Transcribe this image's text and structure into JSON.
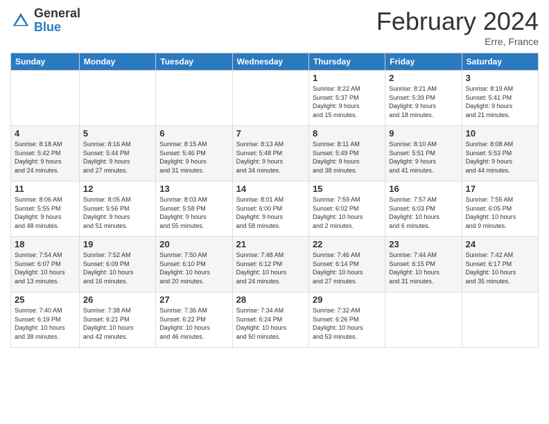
{
  "header": {
    "logo_general": "General",
    "logo_blue": "Blue",
    "month_title": "February 2024",
    "location": "Erre, France"
  },
  "days_of_week": [
    "Sunday",
    "Monday",
    "Tuesday",
    "Wednesday",
    "Thursday",
    "Friday",
    "Saturday"
  ],
  "weeks": [
    {
      "cells": [
        {
          "day": "",
          "info": ""
        },
        {
          "day": "",
          "info": ""
        },
        {
          "day": "",
          "info": ""
        },
        {
          "day": "",
          "info": ""
        },
        {
          "day": "1",
          "info": "Sunrise: 8:22 AM\nSunset: 5:37 PM\nDaylight: 9 hours\nand 15 minutes."
        },
        {
          "day": "2",
          "info": "Sunrise: 8:21 AM\nSunset: 5:39 PM\nDaylight: 9 hours\nand 18 minutes."
        },
        {
          "day": "3",
          "info": "Sunrise: 8:19 AM\nSunset: 5:41 PM\nDaylight: 9 hours\nand 21 minutes."
        }
      ]
    },
    {
      "cells": [
        {
          "day": "4",
          "info": "Sunrise: 8:18 AM\nSunset: 5:42 PM\nDaylight: 9 hours\nand 24 minutes."
        },
        {
          "day": "5",
          "info": "Sunrise: 8:16 AM\nSunset: 5:44 PM\nDaylight: 9 hours\nand 27 minutes."
        },
        {
          "day": "6",
          "info": "Sunrise: 8:15 AM\nSunset: 5:46 PM\nDaylight: 9 hours\nand 31 minutes."
        },
        {
          "day": "7",
          "info": "Sunrise: 8:13 AM\nSunset: 5:48 PM\nDaylight: 9 hours\nand 34 minutes."
        },
        {
          "day": "8",
          "info": "Sunrise: 8:11 AM\nSunset: 5:49 PM\nDaylight: 9 hours\nand 38 minutes."
        },
        {
          "day": "9",
          "info": "Sunrise: 8:10 AM\nSunset: 5:51 PM\nDaylight: 9 hours\nand 41 minutes."
        },
        {
          "day": "10",
          "info": "Sunrise: 8:08 AM\nSunset: 5:53 PM\nDaylight: 9 hours\nand 44 minutes."
        }
      ]
    },
    {
      "cells": [
        {
          "day": "11",
          "info": "Sunrise: 8:06 AM\nSunset: 5:55 PM\nDaylight: 9 hours\nand 48 minutes."
        },
        {
          "day": "12",
          "info": "Sunrise: 8:05 AM\nSunset: 5:56 PM\nDaylight: 9 hours\nand 51 minutes."
        },
        {
          "day": "13",
          "info": "Sunrise: 8:03 AM\nSunset: 5:58 PM\nDaylight: 9 hours\nand 55 minutes."
        },
        {
          "day": "14",
          "info": "Sunrise: 8:01 AM\nSunset: 6:00 PM\nDaylight: 9 hours\nand 58 minutes."
        },
        {
          "day": "15",
          "info": "Sunrise: 7:59 AM\nSunset: 6:02 PM\nDaylight: 10 hours\nand 2 minutes."
        },
        {
          "day": "16",
          "info": "Sunrise: 7:57 AM\nSunset: 6:03 PM\nDaylight: 10 hours\nand 6 minutes."
        },
        {
          "day": "17",
          "info": "Sunrise: 7:55 AM\nSunset: 6:05 PM\nDaylight: 10 hours\nand 9 minutes."
        }
      ]
    },
    {
      "cells": [
        {
          "day": "18",
          "info": "Sunrise: 7:54 AM\nSunset: 6:07 PM\nDaylight: 10 hours\nand 13 minutes."
        },
        {
          "day": "19",
          "info": "Sunrise: 7:52 AM\nSunset: 6:09 PM\nDaylight: 10 hours\nand 16 minutes."
        },
        {
          "day": "20",
          "info": "Sunrise: 7:50 AM\nSunset: 6:10 PM\nDaylight: 10 hours\nand 20 minutes."
        },
        {
          "day": "21",
          "info": "Sunrise: 7:48 AM\nSunset: 6:12 PM\nDaylight: 10 hours\nand 24 minutes."
        },
        {
          "day": "22",
          "info": "Sunrise: 7:46 AM\nSunset: 6:14 PM\nDaylight: 10 hours\nand 27 minutes."
        },
        {
          "day": "23",
          "info": "Sunrise: 7:44 AM\nSunset: 6:15 PM\nDaylight: 10 hours\nand 31 minutes."
        },
        {
          "day": "24",
          "info": "Sunrise: 7:42 AM\nSunset: 6:17 PM\nDaylight: 10 hours\nand 35 minutes."
        }
      ]
    },
    {
      "cells": [
        {
          "day": "25",
          "info": "Sunrise: 7:40 AM\nSunset: 6:19 PM\nDaylight: 10 hours\nand 38 minutes."
        },
        {
          "day": "26",
          "info": "Sunrise: 7:38 AM\nSunset: 6:21 PM\nDaylight: 10 hours\nand 42 minutes."
        },
        {
          "day": "27",
          "info": "Sunrise: 7:36 AM\nSunset: 6:22 PM\nDaylight: 10 hours\nand 46 minutes."
        },
        {
          "day": "28",
          "info": "Sunrise: 7:34 AM\nSunset: 6:24 PM\nDaylight: 10 hours\nand 50 minutes."
        },
        {
          "day": "29",
          "info": "Sunrise: 7:32 AM\nSunset: 6:26 PM\nDaylight: 10 hours\nand 53 minutes."
        },
        {
          "day": "",
          "info": ""
        },
        {
          "day": "",
          "info": ""
        }
      ]
    }
  ]
}
